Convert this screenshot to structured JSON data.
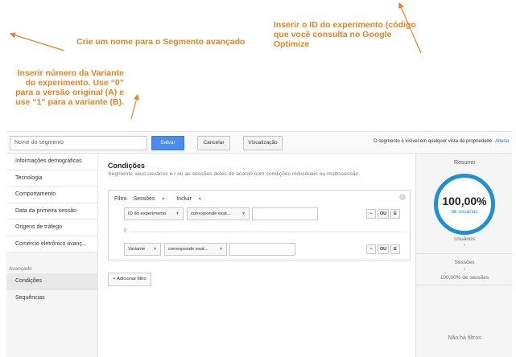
{
  "annotations": {
    "name_tip": "Crie um nome para o Segmento avançado",
    "id_tip": "Inserir o ID do experimento (código que você consulta no Google Optimize",
    "variant_tip": "Inserir número da Variante do experimento. Use “0” para a versão original (A) e use “1” para a variante (B)."
  },
  "topbar": {
    "name_placeholder": "Nome do segmento",
    "save_label": "Salvar",
    "cancel_label": "Cancelar",
    "view_label": "Visualização",
    "visibility_text": "O segmento é visível em qualquer vista da propriedade",
    "change_link": "Alterar"
  },
  "nav": {
    "items": [
      {
        "label": "Informações demográficas"
      },
      {
        "label": "Tecnologia"
      },
      {
        "label": "Comportamento"
      },
      {
        "label": "Data da primeira sessão"
      },
      {
        "label": "Origens de tráfego"
      },
      {
        "label": "Comércio eletrônico avanç..."
      }
    ],
    "advanced_label": "Avançado",
    "advanced_items": [
      {
        "label": "Condições"
      },
      {
        "label": "Sequências"
      }
    ]
  },
  "main": {
    "title": "Condições",
    "subtitle": "Segmente seus usuários e / ou as sessões deles de acordo com condições individuais ou multissessão.",
    "filter_label": "Filtro",
    "scope": "Sessões",
    "include": "Incluir",
    "row1": {
      "dimension": "ID do experimento",
      "operator": "corresponde exat..."
    },
    "row2": {
      "dimension": "Variante",
      "operator": "corresponde exat..."
    },
    "minus": "−",
    "ou": "OU",
    "e": "E",
    "and_separator": "E",
    "add_filter": "+ Adicionar filtro",
    "close_glyph": "×"
  },
  "summary": {
    "title": "Resumo",
    "percent": "100,00%",
    "percent_label": "de usuários",
    "users_label": "Usuários",
    "users_value": "-",
    "sessions_label": "Sessões",
    "sessions_value": "-",
    "sessions_pct": "100,00% de sessões",
    "no_filters": "Não há filtros"
  },
  "colors": {
    "annotation": "#e8811f",
    "primary_button": "#4a8af4",
    "ring": "#1f8fd6"
  }
}
